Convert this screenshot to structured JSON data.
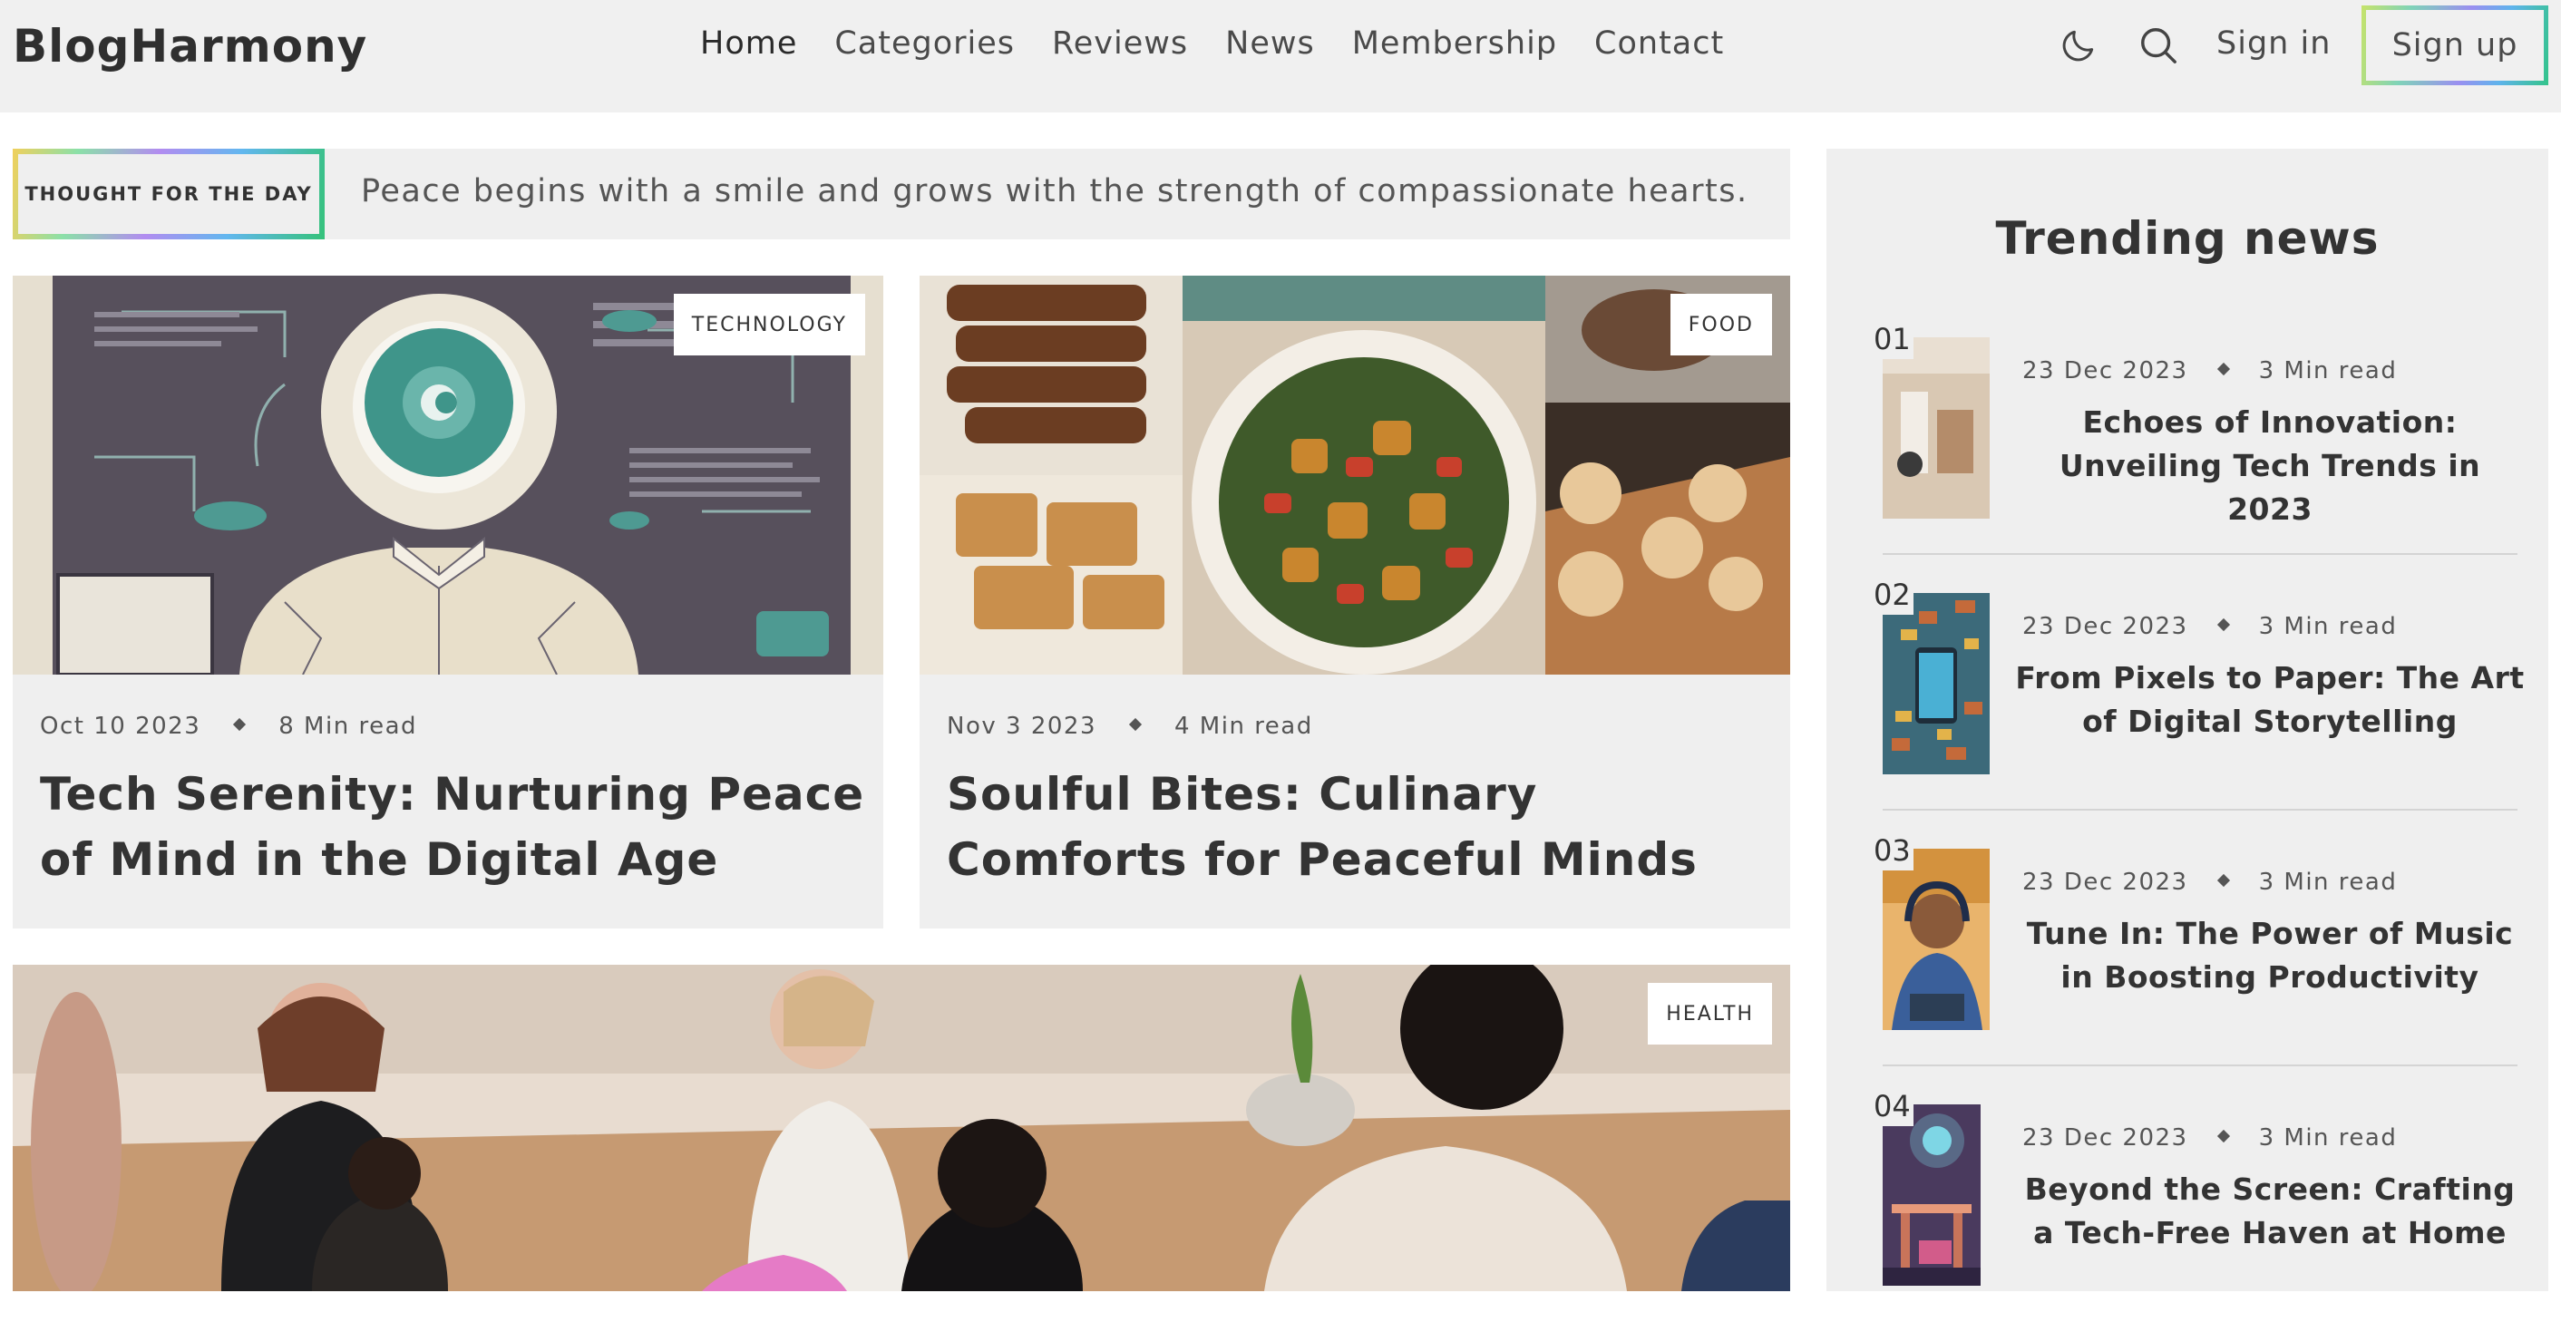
{
  "header": {
    "logo": "BlogHarmony",
    "nav": [
      "Home",
      "Categories",
      "Reviews",
      "News",
      "Membership",
      "Contact"
    ],
    "theme_icon": "moon-icon",
    "search_icon": "search-icon",
    "signin_label": "Sign in",
    "signup_label": "Sign up"
  },
  "thought": {
    "label": "THOUGHT FOR THE DAY",
    "text": "Peace begins with a smile and grows with the strength of compassionate hearts."
  },
  "cards": [
    {
      "tag": "TECHNOLOGY",
      "date": "Oct 10 2023",
      "read_time": "8 Min read",
      "title": "Tech Serenity: Nurturing Peace of Mind in the Digital Age"
    },
    {
      "tag": "FOOD",
      "date": "Nov 3 2023",
      "read_time": "4 Min read",
      "title": "Soulful Bites: Culinary Comforts for Peaceful Minds"
    },
    {
      "tag": "HEALTH"
    }
  ],
  "trending": {
    "title": "Trending news",
    "items": [
      {
        "num": "01",
        "date": "23 Dec 2023",
        "read_time": "3 Min read",
        "title": "Echoes of Innovation: Unveiling Tech Trends in 2023"
      },
      {
        "num": "02",
        "date": "23 Dec 2023",
        "read_time": "3 Min read",
        "title": "From Pixels to Paper: The Art of Digital Storytelling"
      },
      {
        "num": "03",
        "date": "23 Dec 2023",
        "read_time": "3 Min read",
        "title": "Tune In: The Power of Music in Boosting Productivity"
      },
      {
        "num": "04",
        "date": "23 Dec 2023",
        "read_time": "3 Min read",
        "title": "Beyond the Screen: Crafting a Tech-Free Haven at Home"
      }
    ]
  },
  "colors": {
    "background": "#ffffff",
    "panel": "#efefef",
    "text": "#333333",
    "accent_gradient": [
      "#c6e36a",
      "#9a8ff0",
      "#5fb3ec",
      "#33c48a"
    ]
  }
}
